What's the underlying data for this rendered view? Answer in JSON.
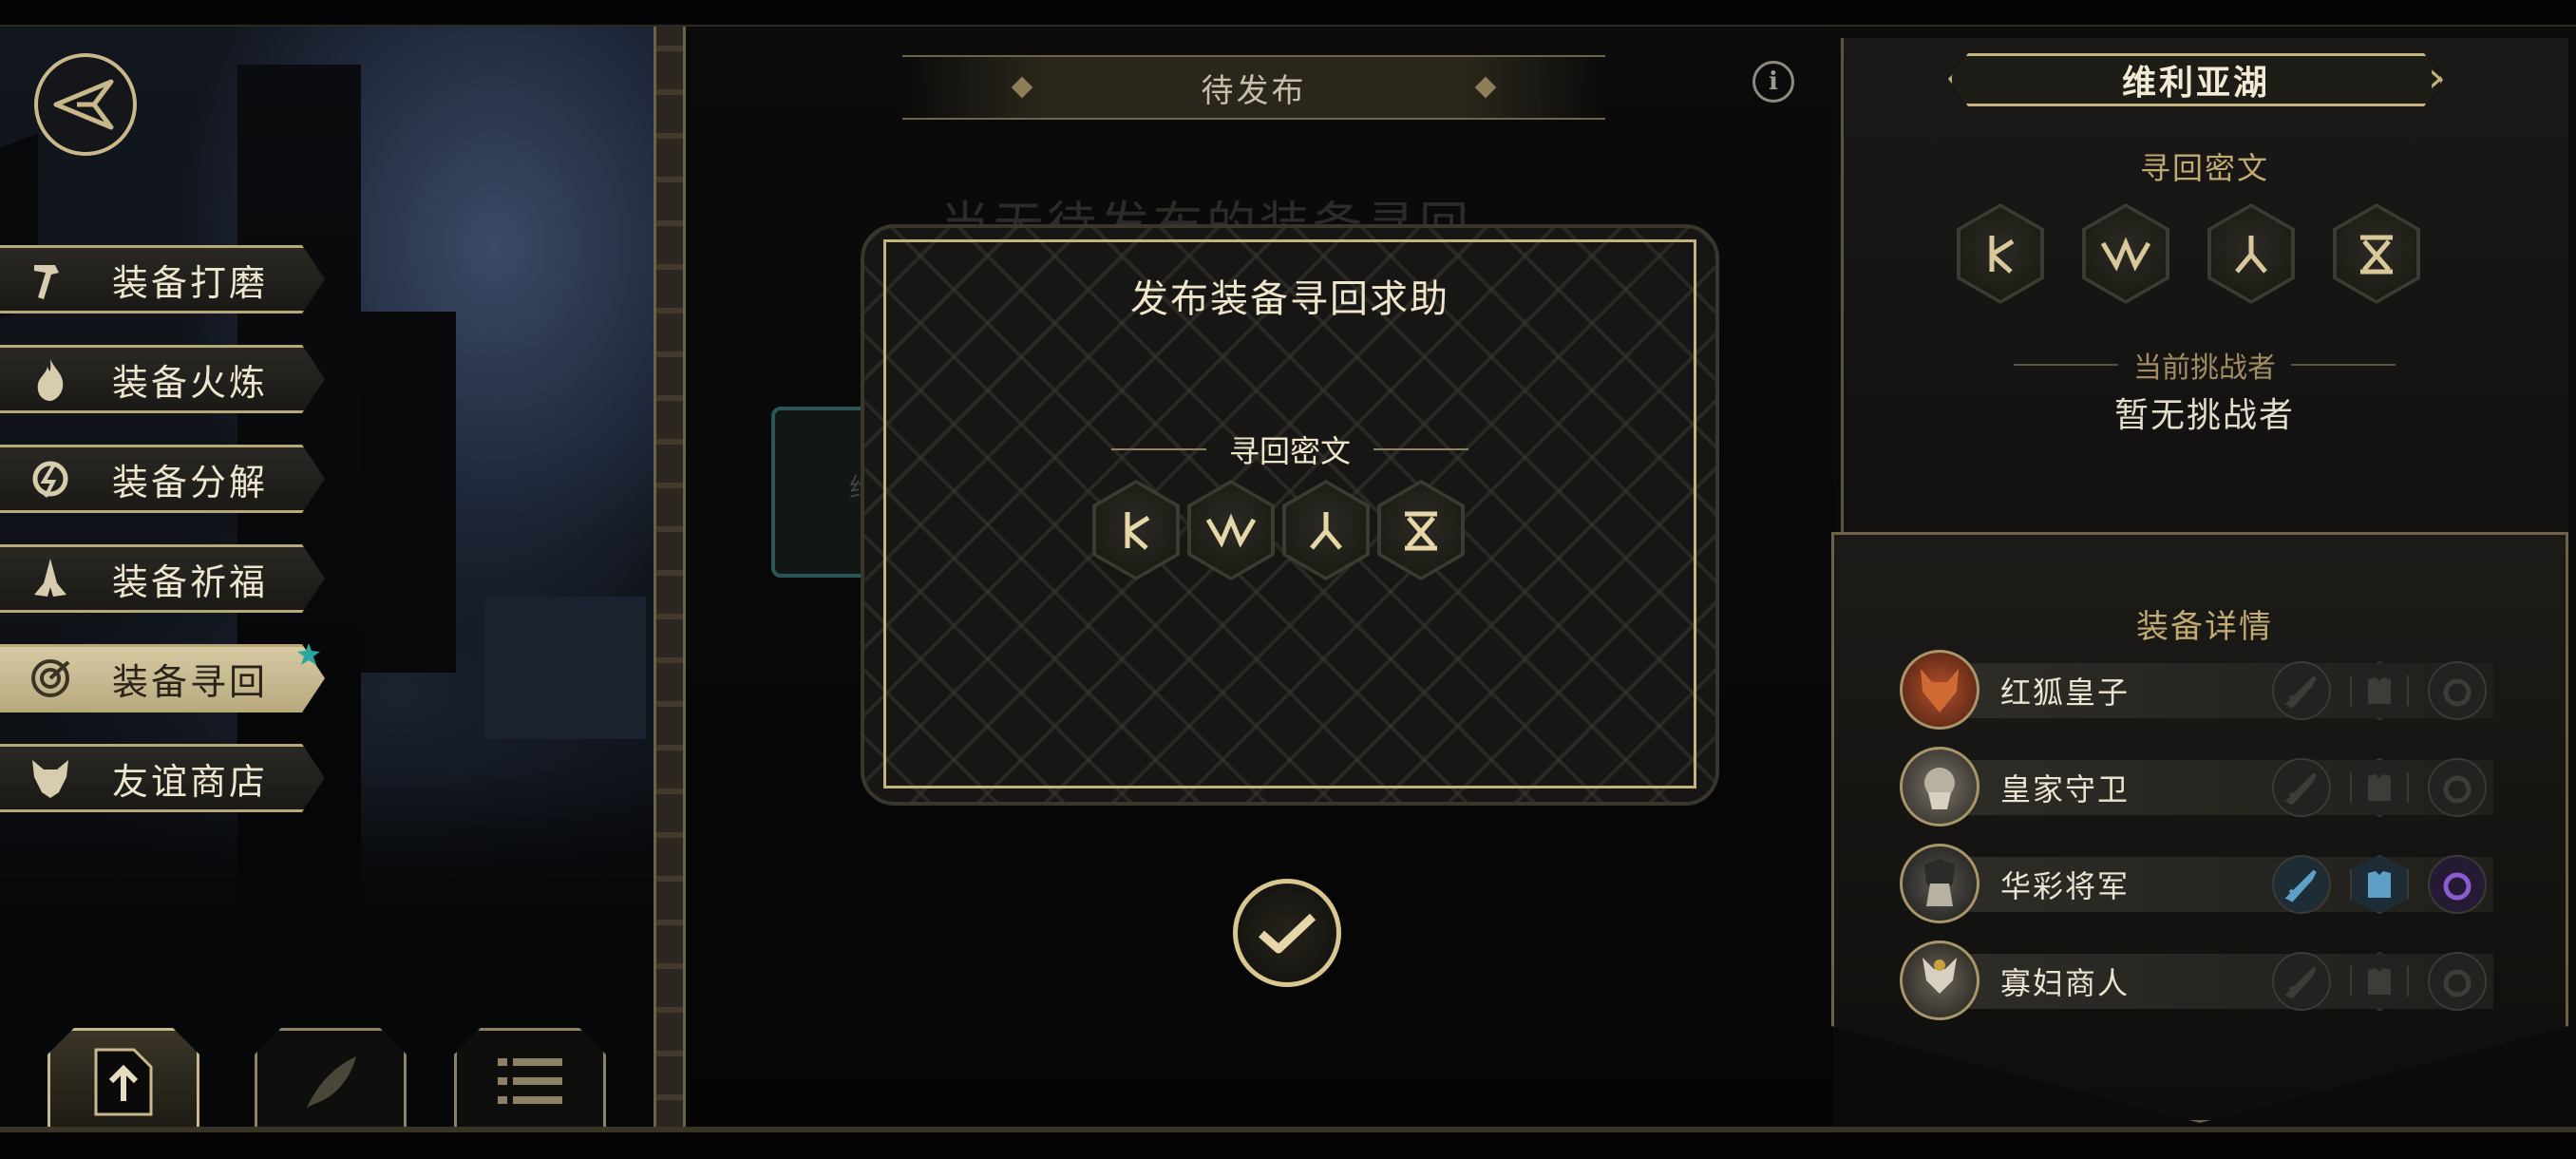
{
  "left_menu": {
    "items": [
      {
        "label": "装备打磨",
        "icon": "hammer-icon",
        "active": false
      },
      {
        "label": "装备火炼",
        "icon": "flame-icon",
        "active": false
      },
      {
        "label": "装备分解",
        "icon": "disassemble-icon",
        "active": false
      },
      {
        "label": "装备祈福",
        "icon": "prayer-icon",
        "active": false
      },
      {
        "label": "装备寻回",
        "icon": "target-icon",
        "active": true
      },
      {
        "label": "友谊商店",
        "icon": "fox-icon",
        "active": false
      }
    ],
    "bottom_tabs": [
      {
        "icon": "upload-icon",
        "active": true
      },
      {
        "icon": "feather-icon",
        "active": false
      },
      {
        "icon": "list-icon",
        "active": false
      }
    ]
  },
  "center": {
    "header_title": "待发布",
    "background_heading": "当无待发布的装备寻回",
    "ghost_card_text": "维",
    "dialog": {
      "title": "发布装备寻回求助",
      "cipher_label": "寻回密文",
      "runes": [
        "rune-a",
        "rune-b",
        "rune-a",
        "rune-c"
      ]
    }
  },
  "right_panel": {
    "location": "维利亚湖",
    "cipher_label": "寻回密文",
    "runes": [
      "rune-a",
      "rune-b",
      "rune-a",
      "rune-c"
    ],
    "challenger_label": "当前挑战者",
    "challenger_value": "暂无挑战者",
    "equip_label": "装备详情",
    "heroes": [
      {
        "name": "红狐皇子",
        "avatar": "red-fox-avatar",
        "equipped": [
          false,
          false,
          false
        ]
      },
      {
        "name": "皇家守卫",
        "avatar": "royal-guard-avatar",
        "equipped": [
          false,
          false,
          false
        ]
      },
      {
        "name": "华彩将军",
        "avatar": "general-avatar",
        "equipped": [
          true,
          true,
          true
        ]
      },
      {
        "name": "寡妇商人",
        "avatar": "widow-merchant-avatar",
        "equipped": [
          false,
          false,
          false
        ]
      }
    ]
  },
  "colors": {
    "gold": "#c5b37e",
    "equip_blue": "#5d9fc6",
    "ring_purple": "#8a5ccf",
    "badge_teal": "#2aa6a0"
  }
}
